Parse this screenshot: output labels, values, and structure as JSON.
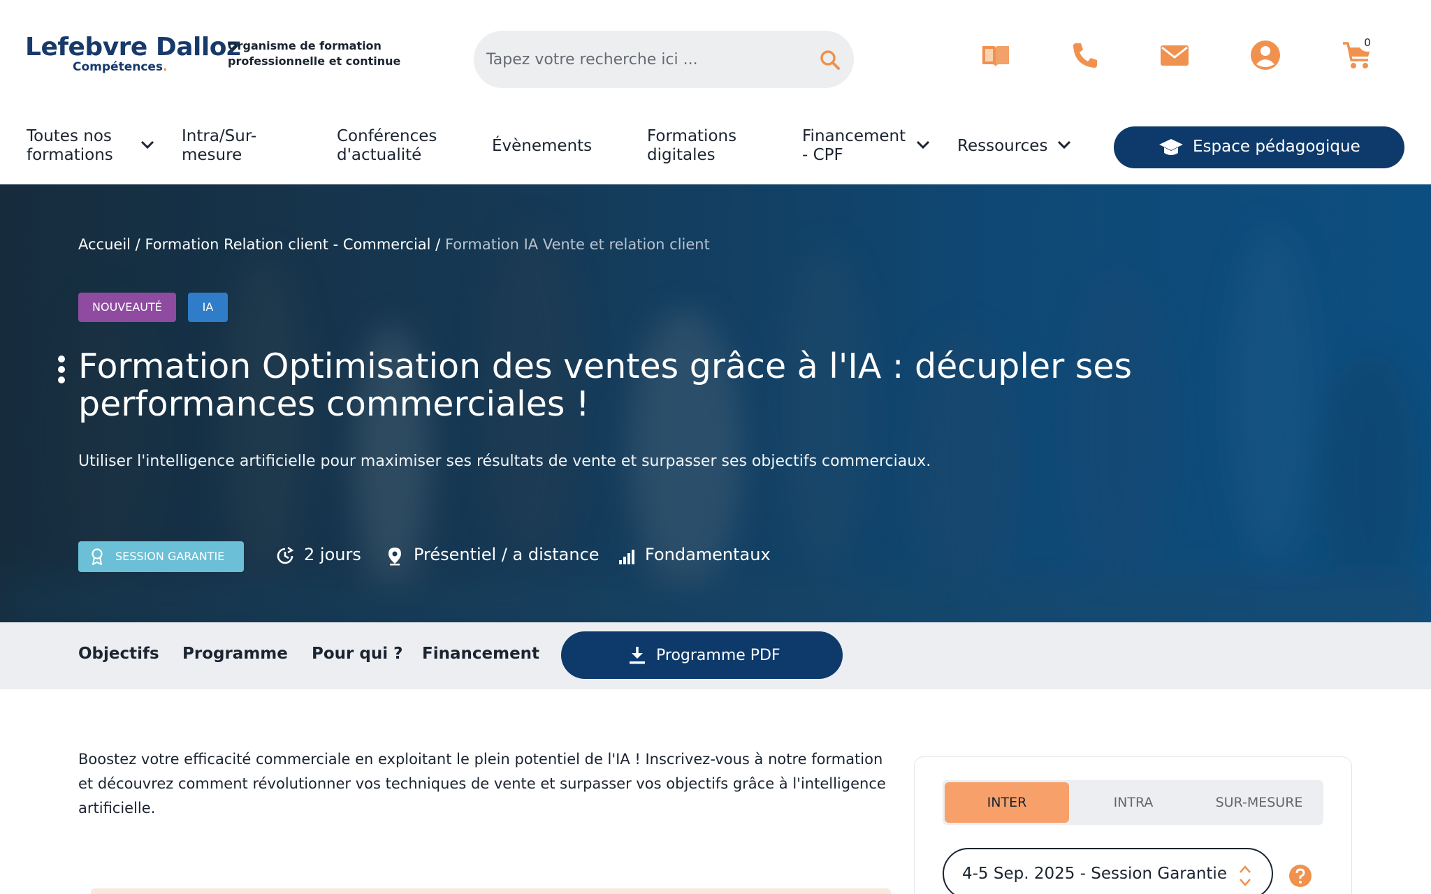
{
  "header": {
    "logo_main": "Lefebvre Dalloz",
    "logo_sub": "Compétences",
    "logo_dot": ".",
    "tagline_line1": "Organisme de formation",
    "tagline_line2": "professionnelle et continue",
    "search_placeholder": "Tapez votre recherche ici ...",
    "cart_count": "0",
    "icons": [
      "book-icon",
      "phone-icon",
      "mail-icon",
      "user-icon",
      "cart-icon"
    ],
    "accent_color": "#f0914e"
  },
  "nav": {
    "items": [
      {
        "line1": "Toutes nos",
        "line2": "formations"
      },
      {
        "line1": "Intra/Sur-",
        "line2": "mesure"
      },
      {
        "line1": "Conférences",
        "line2": "d'actualité"
      },
      {
        "line1": "Évènements",
        "line2": ""
      },
      {
        "line1": "Formations",
        "line2": "digitales"
      },
      {
        "line1": "Financement",
        "line2": "- CPF"
      },
      {
        "line1": "Ressources",
        "line2": ""
      }
    ],
    "espace_label": "Espace pédagogique",
    "brand_color": "#0d3a6b"
  },
  "hero": {
    "breadcrumb": {
      "home": "Accueil",
      "sep1": " / ",
      "category": "Formation Relation client - Commercial",
      "sep2": " / ",
      "current": "Formation IA Vente et relation client"
    },
    "badges": {
      "new": "NOUVEAUTÉ",
      "ia": "IA"
    },
    "title": "Formation Optimisation des ventes grâce à l'IA : décupler ses performances commerciales !",
    "subtitle": "Utiliser l'intelligence artificielle pour maximiser ses résultats de vente et surpasser ses objectifs commerciaux.",
    "session_badge": "SESSION GARANTIE",
    "duration": "2 jours",
    "location": "Présentiel / a distance",
    "level": "Fondamentaux"
  },
  "anchors": {
    "objectifs": "Objectifs",
    "programme": "Programme",
    "pour_qui": "Pour qui ?",
    "financement": "Financement",
    "pdf": "Programme PDF"
  },
  "content": {
    "intro": "Boostez votre efficacité commerciale en exploitant le plein potentiel de l'IA ! Inscrivez-vous à notre formation et découvrez comment révolutionner vos techniques de vente et surpasser vos objectifs grâce à l'intelligence artificielle."
  },
  "card": {
    "tabs": [
      "INTER",
      "INTRA",
      "SUR-MESURE"
    ],
    "active_tab": "INTER",
    "session_value": "4-5 Sep. 2025 - Session Garantie",
    "tab_active_color": "#f7a06a"
  }
}
